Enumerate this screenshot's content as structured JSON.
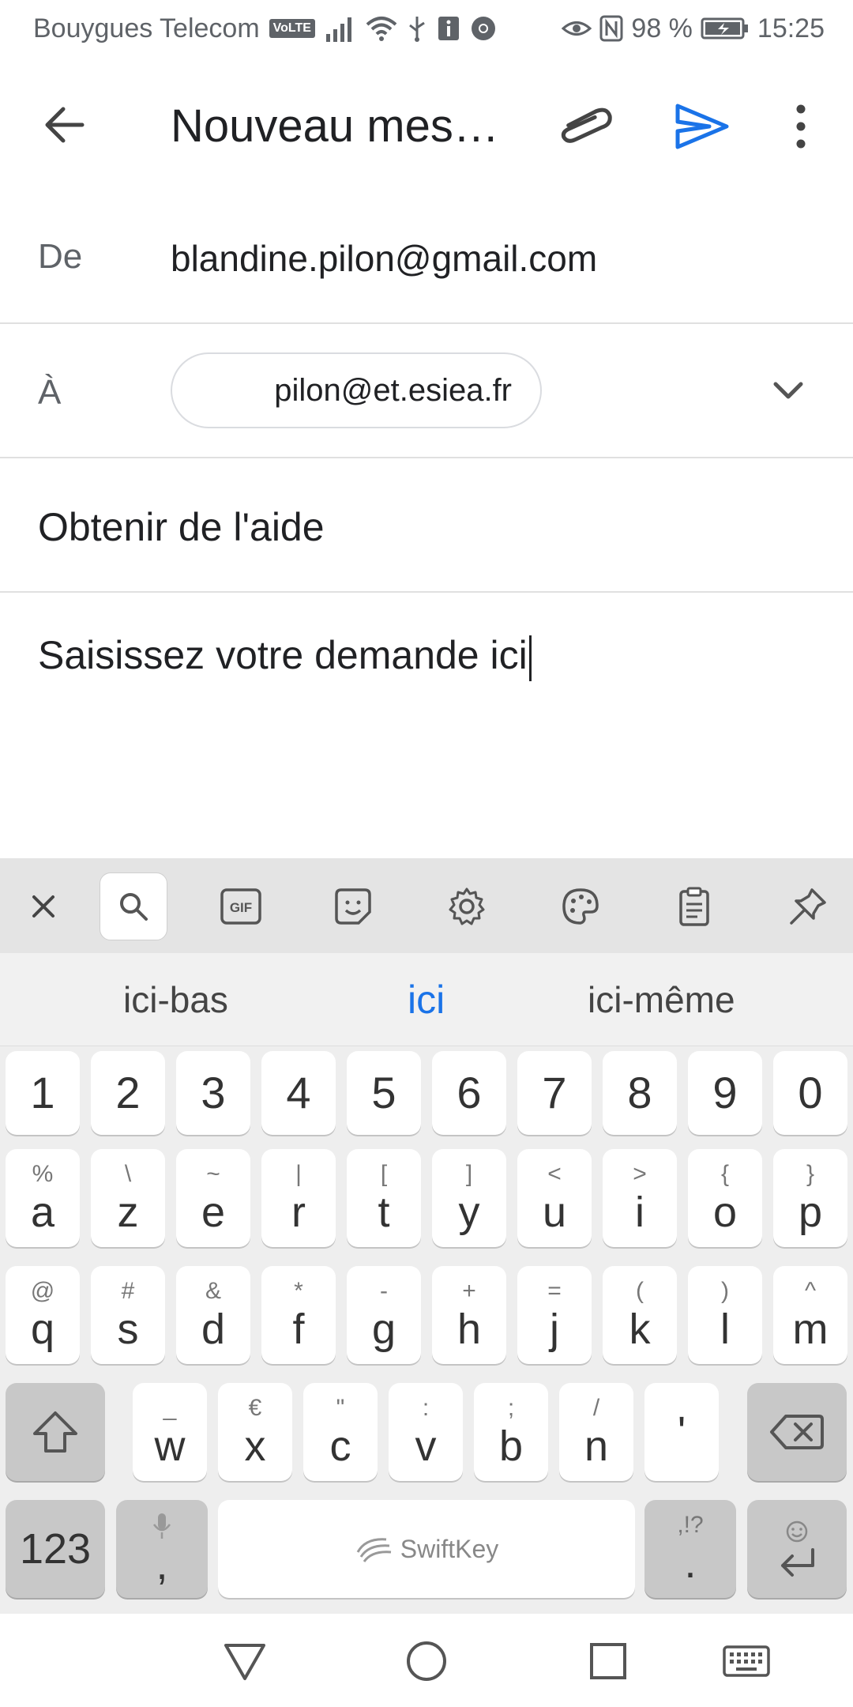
{
  "status_bar": {
    "carrier": "Bouygues Telecom",
    "volte": "VoLTE",
    "battery": "98 %",
    "time": "15:25",
    "icons": [
      "signal-icon",
      "wifi-icon",
      "usb-icon",
      "info-icon",
      "chrome-icon",
      "eye-icon",
      "nfc-icon",
      "battery-charging-icon"
    ]
  },
  "app_bar": {
    "title": "Nouveau mes…"
  },
  "compose": {
    "from_label": "De",
    "from_value": "blandine.pilon@gmail.com",
    "to_label": "À",
    "to_chip": "pilon@et.esiea.fr",
    "subject": "Obtenir de l'aide",
    "body": "Saisissez votre demande ici"
  },
  "keyboard": {
    "toolbar": {
      "gif_label": "GIF"
    },
    "suggestions": [
      "ici-bas",
      "ici",
      "ici-même"
    ],
    "row_numbers": [
      "1",
      "2",
      "3",
      "4",
      "5",
      "6",
      "7",
      "8",
      "9",
      "0"
    ],
    "row1": [
      {
        "main": "a",
        "sec": "%"
      },
      {
        "main": "z",
        "sec": "\\"
      },
      {
        "main": "e",
        "sec": "~"
      },
      {
        "main": "r",
        "sec": "|"
      },
      {
        "main": "t",
        "sec": "["
      },
      {
        "main": "y",
        "sec": "]"
      },
      {
        "main": "u",
        "sec": "<"
      },
      {
        "main": "i",
        "sec": ">"
      },
      {
        "main": "o",
        "sec": "{"
      },
      {
        "main": "p",
        "sec": "}"
      }
    ],
    "row2": [
      {
        "main": "q",
        "sec": "@"
      },
      {
        "main": "s",
        "sec": "#"
      },
      {
        "main": "d",
        "sec": "&"
      },
      {
        "main": "f",
        "sec": "*"
      },
      {
        "main": "g",
        "sec": "-"
      },
      {
        "main": "h",
        "sec": "+"
      },
      {
        "main": "j",
        "sec": "="
      },
      {
        "main": "k",
        "sec": "("
      },
      {
        "main": "l",
        "sec": ")"
      },
      {
        "main": "m",
        "sec": "^"
      }
    ],
    "row3": [
      {
        "main": "w",
        "sec": "_"
      },
      {
        "main": "x",
        "sec": "€"
      },
      {
        "main": "c",
        "sec": "\""
      },
      {
        "main": "v",
        "sec": ":"
      },
      {
        "main": "b",
        "sec": ";"
      },
      {
        "main": "n",
        "sec": "/"
      },
      {
        "main": "'",
        "sec": ""
      }
    ],
    "numbers_key": "123",
    "comma_key": ",",
    "space_brand": "SwiftKey",
    "period_key": ".",
    "period_sec": ",!?"
  }
}
